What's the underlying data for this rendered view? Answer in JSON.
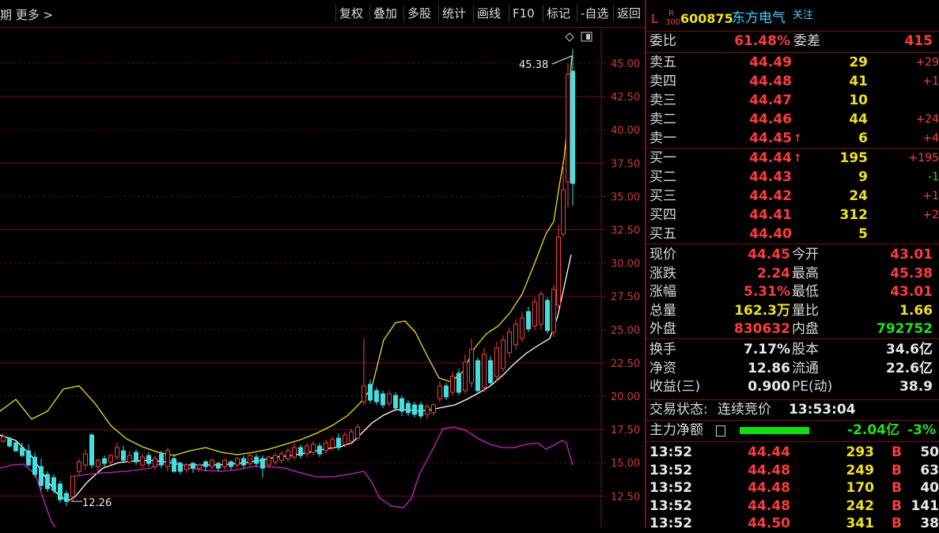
{
  "toolbar": {
    "left_text": "期 更多 >",
    "buttons": [
      "复权",
      "叠加",
      "多股",
      "统计",
      "画线",
      "F10",
      "标记",
      "-自选",
      "返回"
    ]
  },
  "chart": {
    "price_axis_labels": [
      "45.00",
      "42.50",
      "40.00",
      "37.50",
      "35.00",
      "32.50",
      "30.00",
      "27.50",
      "25.00",
      "22.50",
      "20.00",
      "17.50",
      "15.00",
      "12.50"
    ],
    "high_marker": "45.38",
    "low_marker": "12.26",
    "colors": {
      "up": "#ff3c3c",
      "down": "#40e0e0",
      "ma1": "#ffffff",
      "band": "#e8e020",
      "indicator": "#d020d0",
      "grid": "#7a1010"
    }
  },
  "header": {
    "market_tag": "L",
    "board_tag_top": "R",
    "board_tag_bottom": "300",
    "code": "600875",
    "name": "东方电气",
    "follow": "关注"
  },
  "commission": {
    "ratio_label": "委比",
    "ratio_value": "61.48%",
    "diff_label": "委差",
    "diff_value": "415"
  },
  "asks": [
    {
      "label": "卖五",
      "price": "44.49",
      "vol": "29",
      "chg": "+29",
      "arrow": ""
    },
    {
      "label": "卖四",
      "price": "44.48",
      "vol": "41",
      "chg": "+1",
      "arrow": ""
    },
    {
      "label": "卖三",
      "price": "44.47",
      "vol": "10",
      "chg": "",
      "arrow": ""
    },
    {
      "label": "卖二",
      "price": "44.46",
      "vol": "44",
      "chg": "+24",
      "arrow": ""
    },
    {
      "label": "卖一",
      "price": "44.45",
      "vol": "6",
      "chg": "+4",
      "arrow": "↑"
    }
  ],
  "bids": [
    {
      "label": "买一",
      "price": "44.44",
      "vol": "195",
      "chg": "+195",
      "arrow": "↑"
    },
    {
      "label": "买二",
      "price": "44.43",
      "vol": "9",
      "chg": "-1",
      "arrow": ""
    },
    {
      "label": "买三",
      "price": "44.42",
      "vol": "24",
      "chg": "+1",
      "arrow": ""
    },
    {
      "label": "买四",
      "price": "44.41",
      "vol": "312",
      "chg": "+2",
      "arrow": ""
    },
    {
      "label": "买五",
      "price": "44.40",
      "vol": "5",
      "chg": "",
      "arrow": ""
    }
  ],
  "quote": [
    {
      "l1": "现价",
      "v1": "44.45",
      "l2": "今开",
      "v2": "43.01"
    },
    {
      "l1": "涨跌",
      "v1": "2.24",
      "l2": "最高",
      "v2": "45.38"
    },
    {
      "l1": "涨幅",
      "v1": "5.31%",
      "l2": "最低",
      "v2": "43.01"
    },
    {
      "l1": "总量",
      "v1": "162.3万",
      "l2": "量比",
      "v2": "1.66"
    },
    {
      "l1": "外盘",
      "v1": "830632",
      "l2": "内盘",
      "v2": "792752"
    }
  ],
  "fund": [
    {
      "l1": "换手",
      "v1": "7.17%",
      "l2": "股本",
      "v2": "34.6亿"
    },
    {
      "l1": "净资",
      "v1": "12.86",
      "l2": "流通",
      "v2": "22.6亿"
    },
    {
      "l1": "收益(三)",
      "v1": "0.900",
      "l2": "PE(动)",
      "v2": "38.9"
    }
  ],
  "status": {
    "label": "交易状态:",
    "value": "连续竞价",
    "time": "13:53:04"
  },
  "main_flow": {
    "label": "主力净额",
    "value": "-2.04亿",
    "pct": "-3%"
  },
  "ticks": [
    {
      "time": "13:52",
      "price": "44.44",
      "vol": "293",
      "side": "B",
      "num": "50"
    },
    {
      "time": "13:52",
      "price": "44.48",
      "vol": "249",
      "side": "B",
      "num": "63"
    },
    {
      "time": "13:52",
      "price": "44.48",
      "vol": "170",
      "side": "B",
      "num": "40"
    },
    {
      "time": "13:52",
      "price": "44.48",
      "vol": "242",
      "side": "B",
      "num": "141"
    },
    {
      "time": "13:52",
      "price": "44.50",
      "vol": "341",
      "side": "B",
      "num": "38"
    }
  ]
}
